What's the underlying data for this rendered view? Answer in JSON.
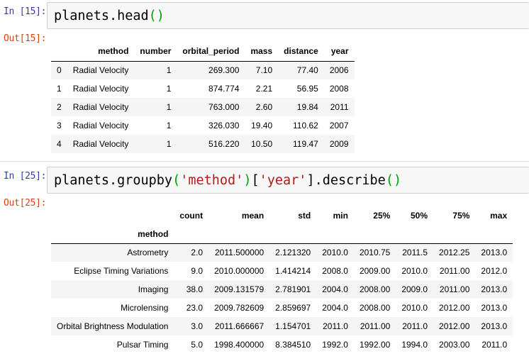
{
  "cell1": {
    "in_prompt": "In [15]:",
    "out_prompt": "Out[15]:",
    "code": {
      "obj": "planets.head",
      "open": "(",
      "close": ")"
    },
    "table": {
      "columns": [
        "method",
        "number",
        "orbital_period",
        "mass",
        "distance",
        "year"
      ],
      "rows": [
        {
          "index": "0",
          "cells": [
            "Radial Velocity",
            "1",
            "269.300",
            "7.10",
            "77.40",
            "2006"
          ]
        },
        {
          "index": "1",
          "cells": [
            "Radial Velocity",
            "1",
            "874.774",
            "2.21",
            "56.95",
            "2008"
          ]
        },
        {
          "index": "2",
          "cells": [
            "Radial Velocity",
            "1",
            "763.000",
            "2.60",
            "19.84",
            "2011"
          ]
        },
        {
          "index": "3",
          "cells": [
            "Radial Velocity",
            "1",
            "326.030",
            "19.40",
            "110.62",
            "2007"
          ]
        },
        {
          "index": "4",
          "cells": [
            "Radial Velocity",
            "1",
            "516.220",
            "10.50",
            "119.47",
            "2009"
          ]
        }
      ]
    }
  },
  "cell2": {
    "in_prompt": "In [25]:",
    "out_prompt": "Out[25]:",
    "code": {
      "p1": "planets.groupby",
      "open1": "(",
      "s1": "'method'",
      "close1": ")",
      "br_open": "[",
      "s2": "'year'",
      "br_close": "]",
      "p2": ".describe",
      "open2": "(",
      "close2": ")"
    },
    "table": {
      "index_name": "method",
      "columns": [
        "count",
        "mean",
        "std",
        "min",
        "25%",
        "50%",
        "75%",
        "max"
      ],
      "rows": [
        {
          "index": "Astrometry",
          "cells": [
            "2.0",
            "2011.500000",
            "2.121320",
            "2010.0",
            "2010.75",
            "2011.5",
            "2012.25",
            "2013.0"
          ]
        },
        {
          "index": "Eclipse Timing Variations",
          "cells": [
            "9.0",
            "2010.000000",
            "1.414214",
            "2008.0",
            "2009.00",
            "2010.0",
            "2011.00",
            "2012.0"
          ]
        },
        {
          "index": "Imaging",
          "cells": [
            "38.0",
            "2009.131579",
            "2.781901",
            "2004.0",
            "2008.00",
            "2009.0",
            "2011.00",
            "2013.0"
          ]
        },
        {
          "index": "Microlensing",
          "cells": [
            "23.0",
            "2009.782609",
            "2.859697",
            "2004.0",
            "2008.00",
            "2010.0",
            "2012.00",
            "2013.0"
          ]
        },
        {
          "index": "Orbital Brightness Modulation",
          "cells": [
            "3.0",
            "2011.666667",
            "1.154701",
            "2011.0",
            "2011.00",
            "2011.0",
            "2012.00",
            "2013.0"
          ]
        },
        {
          "index": "Pulsar Timing",
          "cells": [
            "5.0",
            "1998.400000",
            "8.384510",
            "1992.0",
            "1992.00",
            "1994.0",
            "2003.00",
            "2011.0"
          ]
        }
      ]
    }
  }
}
